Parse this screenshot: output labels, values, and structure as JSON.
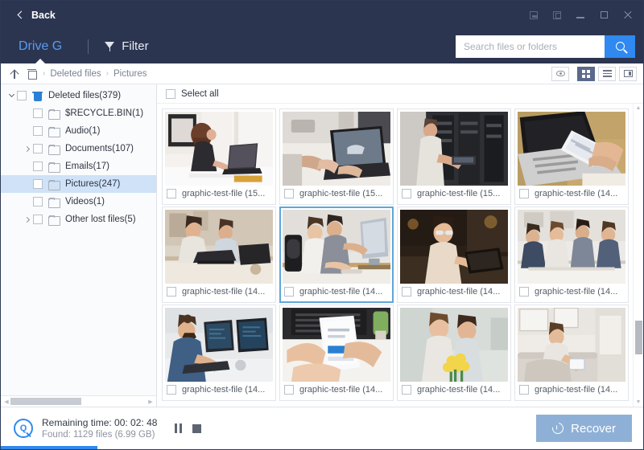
{
  "titlebar": {
    "back_label": "Back",
    "controls": [
      {
        "name": "restore-window-button",
        "glyph": "restore"
      },
      {
        "name": "expand-window-button",
        "glyph": "box"
      },
      {
        "name": "minimize-button",
        "glyph": "min"
      },
      {
        "name": "maximize-button",
        "glyph": "max"
      },
      {
        "name": "close-button",
        "glyph": "close"
      }
    ]
  },
  "navbar": {
    "drive_label": "Drive G",
    "filter_label": "Filter",
    "search_placeholder": "Search files or folders",
    "search_value": ""
  },
  "breadcrumb": {
    "items": [
      "Deleted files",
      "Pictures"
    ],
    "separator": "›"
  },
  "viewtools": [
    {
      "name": "preview-toggle-button",
      "icon": "eye-icon",
      "active": false
    },
    {
      "name": "grid-view-button",
      "icon": "grid-icon",
      "active": true
    },
    {
      "name": "list-view-button",
      "icon": "list-icon",
      "active": false
    },
    {
      "name": "detail-view-button",
      "icon": "pane-icon",
      "active": false
    }
  ],
  "sidebar": {
    "root": {
      "label": "Deleted files(379)",
      "expanded": true,
      "checked": false
    },
    "items": [
      {
        "label": "$RECYCLE.BIN(1)",
        "expandable": false,
        "selected": false
      },
      {
        "label": "Audio(1)",
        "expandable": false,
        "selected": false
      },
      {
        "label": "Documents(107)",
        "expandable": true,
        "selected": false
      },
      {
        "label": "Emails(17)",
        "expandable": false,
        "selected": false
      },
      {
        "label": "Pictures(247)",
        "expandable": false,
        "selected": true
      },
      {
        "label": "Videos(1)",
        "expandable": false,
        "selected": false
      },
      {
        "label": "Other lost files(5)",
        "expandable": true,
        "selected": false
      }
    ]
  },
  "content": {
    "select_all_label": "Select all",
    "tiles": [
      {
        "label": "graphic-test-file (15...",
        "selected": false,
        "scene": "woman-laptop-window"
      },
      {
        "label": "graphic-test-file (15...",
        "selected": false,
        "scene": "hands-laptop-desk"
      },
      {
        "label": "graphic-test-file (15...",
        "selected": false,
        "scene": "man-server-rack"
      },
      {
        "label": "graphic-test-file (14...",
        "selected": false,
        "scene": "phone-over-laptop"
      },
      {
        "label": "graphic-test-file (14...",
        "selected": false,
        "scene": "two-women-cafe"
      },
      {
        "label": "graphic-test-file (14...",
        "selected": true,
        "scene": "couple-at-monitor"
      },
      {
        "label": "graphic-test-file (14...",
        "selected": false,
        "scene": "woman-glasses-dark"
      },
      {
        "label": "graphic-test-file (14...",
        "selected": false,
        "scene": "team-meeting-office"
      },
      {
        "label": "graphic-test-file (14...",
        "selected": false,
        "scene": "man-bun-multimonitor"
      },
      {
        "label": "graphic-test-file (14...",
        "selected": false,
        "scene": "hands-phone-keyboard"
      },
      {
        "label": "graphic-test-file (14...",
        "selected": false,
        "scene": "two-women-flowers"
      },
      {
        "label": "graphic-test-file (14...",
        "selected": false,
        "scene": "woman-sofa-tablet"
      }
    ]
  },
  "statusbar": {
    "remaining_time": "Remaining time: 00: 02: 48",
    "found": "Found: 1129 files (6.99 GB)",
    "pause_name": "pause-scan-button",
    "stop_name": "stop-scan-button",
    "recover_label": "Recover"
  },
  "colors": {
    "titlebar_bg": "#2b3550",
    "accent_blue": "#2f89f0",
    "drive_tab": "#5a9bf0",
    "selection_row": "#cfe2f7",
    "tile_selected_border": "#5fa7d8",
    "recover_bg": "#8fb0d6"
  }
}
